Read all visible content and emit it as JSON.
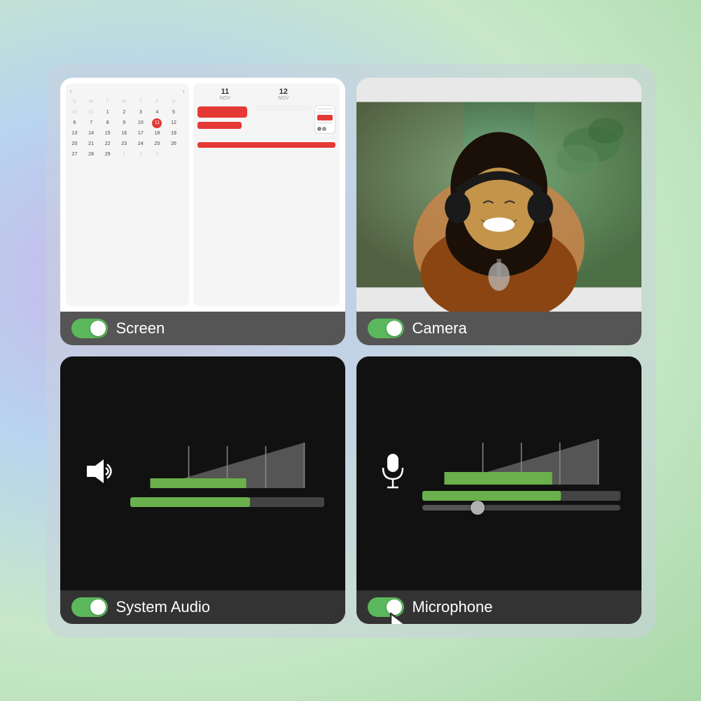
{
  "background": {
    "gradient_start": "#c9b4e8",
    "gradient_mid": "#b8d4f0",
    "gradient_end": "#a8d8a8"
  },
  "cards": {
    "screen": {
      "label": "Screen",
      "toggle_on": true,
      "calendar": {
        "nav_prev": "‹",
        "nav_next": "›",
        "days": [
          "30",
          "31",
          "1",
          "2",
          "3",
          "4",
          "5",
          "6",
          "7",
          "8",
          "9",
          "10",
          "11",
          "12",
          "13",
          "14",
          "15",
          "16",
          "17",
          "18",
          "19",
          "20",
          "21",
          "22",
          "23",
          "24",
          "25",
          "26",
          "27",
          "28",
          "29",
          "1",
          "2",
          "3"
        ],
        "today": "11",
        "col1_label": "NOV 11",
        "col2_label": "NOV 12"
      }
    },
    "camera": {
      "label": "Camera",
      "toggle_on": true
    },
    "system_audio": {
      "label": "System Audio",
      "toggle_on": true,
      "level_percent": 62
    },
    "microphone": {
      "label": "Microphone",
      "toggle_on": true,
      "level_percent": 70,
      "slider_percent": 28
    }
  },
  "colors": {
    "toggle_active": "#5cb85c",
    "level_fill": "#6ab04c",
    "event_red": "#e53935",
    "card_dark": "#111111",
    "card_footer_dark": "#333333",
    "card_footer_light": "#555555"
  }
}
